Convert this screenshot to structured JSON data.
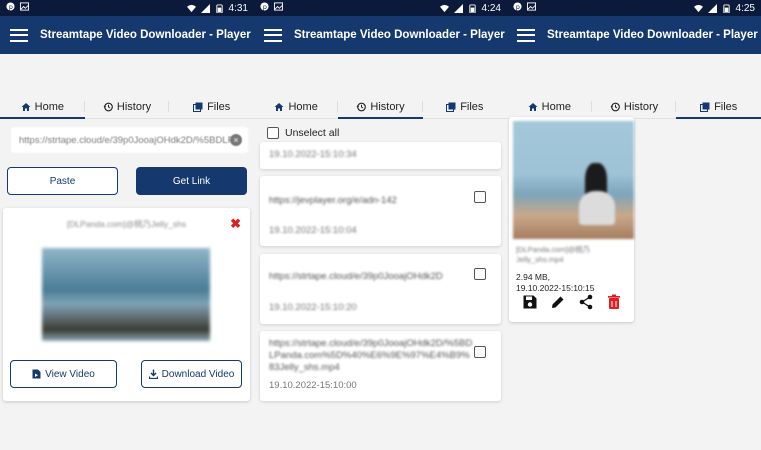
{
  "app_title": "Streamtape Video Downloader - Player",
  "tabs": {
    "home": "Home",
    "history": "History",
    "files": "Files"
  },
  "panel1": {
    "time": "4:31",
    "url_value": "https://strtape.cloud/e/39p0JooajOHdk2D/%5BDLF",
    "paste_label": "Paste",
    "get_link_label": "Get Link",
    "card_title": "[DLPanda.com]@桃乃Jelly_shs",
    "view_video_label": "View Video",
    "download_video_label": "Download Video"
  },
  "panel2": {
    "time": "4:24",
    "unselect_all_label": "Unselect all",
    "items": [
      {
        "url": "",
        "date": "19.10.2022-15:10:34"
      },
      {
        "url": "https://jevplayer.org/e/adn-142",
        "date": "19.10.2022-15:10:04"
      },
      {
        "url": "https://strtape.cloud/e/39p0JooajOHdk2D",
        "date": "19.10.2022-15:10:20"
      },
      {
        "url": "https://strtape.cloud/e/39p0JooajOHdk2D/%5BDLPanda.com%5D%40%E6%9E%97%E4%B9%83Jelly_shs.mp4",
        "date": "19.10.2022-15:10:00"
      }
    ]
  },
  "panel3": {
    "time": "4:25",
    "file_name": "[DLPanda.com]@桃乃Jelly_shs.mp4",
    "file_size": "2.94 MB,",
    "file_date": "19.10.2022-15:10:15",
    "icons": [
      "save-icon",
      "edit-icon",
      "share-icon",
      "delete-icon"
    ],
    "delete_color": "#e02020"
  },
  "colors": {
    "appbar": "#15386f",
    "statusbar": "#0b1a3a",
    "accent": "#15386f"
  }
}
